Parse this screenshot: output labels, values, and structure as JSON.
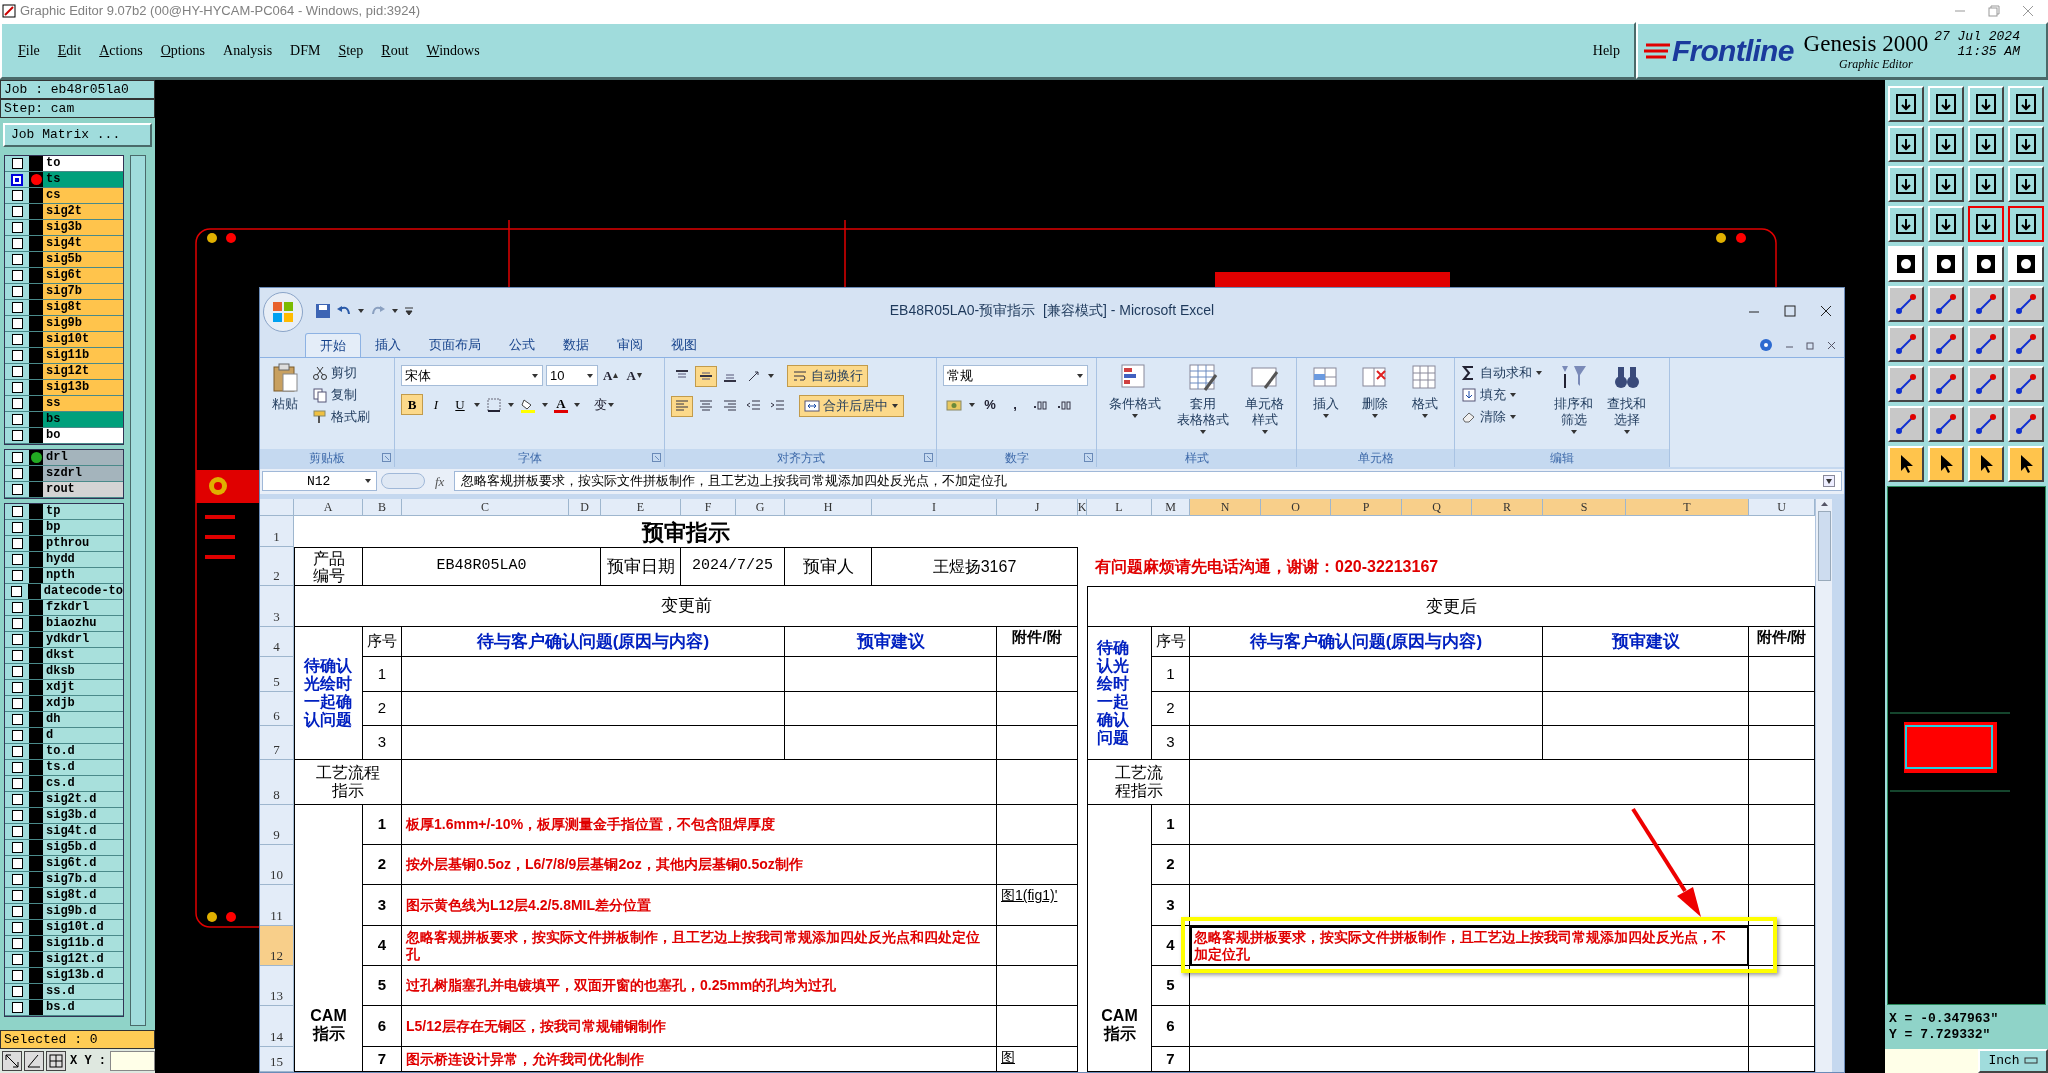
{
  "title_bar": {
    "title": "Graphic Editor 9.07b2 (00@HY-HYCAM-PC064 - Windows, pid:3924)"
  },
  "menu": {
    "items": [
      {
        "label": "File",
        "mnemonic": true
      },
      {
        "label": "Edit",
        "mnemonic": true
      },
      {
        "label": "Actions",
        "mnemonic": true
      },
      {
        "label": "Options",
        "mnemonic": true
      },
      {
        "label": "Analysis",
        "mnemonic": false
      },
      {
        "label": "DFM",
        "mnemonic": false
      },
      {
        "label": "Step",
        "mnemonic": true
      },
      {
        "label": "Rout",
        "mnemonic": true
      },
      {
        "label": "Windows",
        "mnemonic": true
      }
    ],
    "help": "Help"
  },
  "brand": {
    "logo": "Frontline",
    "product": "Genesis 2000",
    "subtitle": "Graphic Editor",
    "date": "27 Jul 2024",
    "time": "11:35 AM"
  },
  "job_panel": {
    "job": "Job : eb48r05la0",
    "step": "Step: cam",
    "matrix_button": "Job Matrix ...",
    "layer_groups": [
      {
        "layers": [
          {
            "name": "to",
            "color": "#ffffff",
            "selected": false
          },
          {
            "name": "ts",
            "color": "#00a07c",
            "selected": true,
            "dot": {
              "color": "#ff0000"
            }
          },
          {
            "name": "cs",
            "color": "#ffc44c",
            "selected": false
          },
          {
            "name": "sig2t",
            "color": "#ffc44c",
            "selected": false
          },
          {
            "name": "sig3b",
            "color": "#ffc44c",
            "selected": false
          },
          {
            "name": "sig4t",
            "color": "#ffc44c",
            "selected": false
          },
          {
            "name": "sig5b",
            "color": "#ffc44c",
            "selected": false
          },
          {
            "name": "sig6t",
            "color": "#ffc44c",
            "selected": false
          },
          {
            "name": "sig7b",
            "color": "#ffc44c",
            "selected": false
          },
          {
            "name": "sig8t",
            "color": "#ffc44c",
            "selected": false
          },
          {
            "name": "sig9b",
            "color": "#ffc44c",
            "selected": false
          },
          {
            "name": "sig10t",
            "color": "#ffc44c",
            "selected": false
          },
          {
            "name": "sig11b",
            "color": "#ffc44c",
            "selected": false
          },
          {
            "name": "sig12t",
            "color": "#ffc44c",
            "selected": false
          },
          {
            "name": "sig13b",
            "color": "#ffc44c",
            "selected": false
          },
          {
            "name": "ss",
            "color": "#ffc44c",
            "selected": false
          },
          {
            "name": "bs",
            "color": "#00a07c",
            "selected": false
          },
          {
            "name": "bo",
            "color": "#ffffff",
            "selected": false
          }
        ]
      },
      {
        "layers": [
          {
            "name": "drl",
            "color": "#a4b4bc",
            "selected": false,
            "dot": {
              "color": "#22aa22"
            }
          },
          {
            "name": "szdrl",
            "color": "#a4b4bc",
            "selected": false
          },
          {
            "name": "rout",
            "color": "#d4d4d4",
            "selected": false
          }
        ]
      },
      {
        "layers": [
          {
            "name": "tp",
            "color": "#a8e0dc",
            "selected": false
          },
          {
            "name": "bp",
            "color": "#a8e0dc",
            "selected": false
          },
          {
            "name": "pthrou",
            "color": "#a8e0dc",
            "selected": false
          },
          {
            "name": "hydd",
            "color": "#a8e0dc",
            "selected": false
          },
          {
            "name": "npth",
            "color": "#a8e0dc",
            "selected": false
          },
          {
            "name": "datecode-to",
            "color": "#a8e0dc",
            "selected": false
          },
          {
            "name": "fzkdrl",
            "color": "#a8e0dc",
            "selected": false
          },
          {
            "name": "biaozhu",
            "color": "#a8e0dc",
            "selected": false
          },
          {
            "name": "ydkdrl",
            "color": "#a8e0dc",
            "selected": false
          },
          {
            "name": "dkst",
            "color": "#a8e0dc",
            "selected": false
          },
          {
            "name": "dksb",
            "color": "#a8e0dc",
            "selected": false
          },
          {
            "name": "xdjt",
            "color": "#a8e0dc",
            "selected": false
          },
          {
            "name": "xdjb",
            "color": "#a8e0dc",
            "selected": false
          },
          {
            "name": "dh",
            "color": "#a8e0dc",
            "selected": false
          },
          {
            "name": "d",
            "color": "#a8e0dc",
            "selected": false
          },
          {
            "name": "to.d",
            "color": "#a8e0dc",
            "selected": false
          },
          {
            "name": "ts.d",
            "color": "#a8e0dc",
            "selected": false
          },
          {
            "name": "cs.d",
            "color": "#a8e0dc",
            "selected": false
          },
          {
            "name": "sig2t.d",
            "color": "#a8e0dc",
            "selected": false
          },
          {
            "name": "sig3b.d",
            "color": "#a8e0dc",
            "selected": false
          },
          {
            "name": "sig4t.d",
            "color": "#a8e0dc",
            "selected": false
          },
          {
            "name": "sig5b.d",
            "color": "#a8e0dc",
            "selected": false
          },
          {
            "name": "sig6t.d",
            "color": "#a8e0dc",
            "selected": false
          },
          {
            "name": "sig7b.d",
            "color": "#a8e0dc",
            "selected": false
          },
          {
            "name": "sig8t.d",
            "color": "#a8e0dc",
            "selected": false
          },
          {
            "name": "sig9b.d",
            "color": "#a8e0dc",
            "selected": false
          },
          {
            "name": "sig10t.d",
            "color": "#a8e0dc",
            "selected": false
          },
          {
            "name": "sig11b.d",
            "color": "#a8e0dc",
            "selected": false
          },
          {
            "name": "sig12t.d",
            "color": "#a8e0dc",
            "selected": false
          },
          {
            "name": "sig13b.d",
            "color": "#a8e0dc",
            "selected": false
          },
          {
            "name": "ss.d",
            "color": "#a8e0dc",
            "selected": false
          },
          {
            "name": "bs.d",
            "color": "#a8e0dc",
            "selected": false
          }
        ]
      }
    ],
    "selected": "Selected : 0",
    "xy_label": "X Y :"
  },
  "excel": {
    "title": "EB48R05LA0-预审指示  [兼容模式] - Microsoft Excel",
    "tabs": [
      {
        "label": "开始",
        "selected": true
      },
      {
        "label": "插入",
        "selected": false
      },
      {
        "label": "页面布局",
        "selected": false
      },
      {
        "label": "公式",
        "selected": false
      },
      {
        "label": "数据",
        "selected": false
      },
      {
        "label": "审阅",
        "selected": false
      },
      {
        "label": "视图",
        "selected": false
      }
    ],
    "groups": [
      {
        "kind": "clipboard",
        "label": "剪贴板",
        "buttons": [
          "粘贴",
          "剪切",
          "复制",
          "格式刷"
        ]
      },
      {
        "kind": "font",
        "label": "字体",
        "font_name": "宋体",
        "font_size": "10",
        "size_buttons": [
          "A",
          "A"
        ],
        "style_buttons": [
          {
            "label": "B",
            "on": true
          },
          {
            "label": "I",
            "on": false
          },
          {
            "label": "U",
            "on": false
          }
        ],
        "color_button": "A",
        "phonetic_button": "变"
      },
      {
        "kind": "alignment",
        "label": "对齐方式",
        "vertical": [
          {
            "on": false
          },
          {
            "on": true
          },
          {
            "on": false
          }
        ],
        "horizontal": [
          {
            "on": true
          },
          {
            "on": false
          },
          {
            "on": false
          }
        ],
        "wrap": {
          "label": "自动换行",
          "on": true
        },
        "merge": {
          "label": "合并后居中",
          "on": true
        }
      },
      {
        "kind": "number",
        "label": "数字",
        "format": "常规",
        "buttons": [
          "%",
          ","
        ]
      },
      {
        "kind": "styles",
        "label": "样式",
        "buttons": [
          [
            "条件格式"
          ],
          [
            "套用",
            "表格格式"
          ],
          [
            "单元格",
            "样式"
          ]
        ]
      },
      {
        "kind": "cells",
        "label": "单元格",
        "buttons": [
          "插入",
          "删除",
          "格式"
        ]
      },
      {
        "kind": "editing",
        "label": "编辑",
        "small": [
          "自动求和",
          "填充",
          "清除"
        ],
        "large": [
          [
            "排序和",
            "筛选"
          ],
          [
            "查找和",
            "选择"
          ]
        ]
      }
    ],
    "name_box": "N12",
    "fx": "fx",
    "formula": "忽略客规拼板要求，按实际文件拼板制作，且工艺边上按我司常规添加四处反光点，不加定位孔",
    "columns": [
      {
        "label": "A",
        "selected": false
      },
      {
        "label": "B",
        "selected": false
      },
      {
        "label": "C",
        "selected": false
      },
      {
        "label": "D",
        "selected": false
      },
      {
        "label": "E",
        "selected": false
      },
      {
        "label": "F",
        "selected": false
      },
      {
        "label": "G",
        "selected": false
      },
      {
        "label": "H",
        "selected": false
      },
      {
        "label": "I",
        "selected": false
      },
      {
        "label": "J",
        "selected": false
      },
      {
        "label": "K",
        "selected": false
      },
      {
        "label": "L",
        "selected": false
      },
      {
        "label": "M",
        "selected": false
      },
      {
        "label": "N",
        "selected": true
      },
      {
        "label": "O",
        "selected": true
      },
      {
        "label": "P",
        "selected": true
      },
      {
        "label": "Q",
        "selected": true
      },
      {
        "label": "R",
        "selected": true
      },
      {
        "label": "S",
        "selected": true
      },
      {
        "label": "T",
        "selected": true
      },
      {
        "label": "U",
        "selected": false
      }
    ],
    "rows": [
      {
        "label": "1",
        "selected": false
      },
      {
        "label": "2",
        "selected": false
      },
      {
        "label": "3",
        "selected": false
      },
      {
        "label": "4",
        "selected": false
      },
      {
        "label": "5",
        "selected": false
      },
      {
        "label": "6",
        "selected": false
      },
      {
        "label": "7",
        "selected": false
      },
      {
        "label": "8",
        "selected": false
      },
      {
        "label": "9",
        "selected": false
      },
      {
        "label": "10",
        "selected": false
      },
      {
        "label": "11",
        "selected": false
      },
      {
        "label": "12",
        "selected": true
      },
      {
        "label": "13",
        "selected": false
      },
      {
        "label": "14",
        "selected": false
      },
      {
        "label": "15",
        "selected": false
      }
    ],
    "sheet_title": "预审指示",
    "info": {
      "product_label": "产品编号",
      "product_no": "EB48R05LA0",
      "date_label": "预审日期",
      "date": "2024/7/25",
      "reviewer_label": "预审人",
      "reviewer": "王煜扬3167"
    },
    "notice": "有问题麻烦请先电话沟通，谢谢：020-32213167",
    "sections": [
      {
        "heading": "变更前",
        "confirm_label": "待确认光绘时一起确认问题",
        "seq_header": "序号",
        "question_header": "待与客户确认问题(原因与内容)",
        "suggestion_header": "预审建议",
        "attachment_header": "附件/附",
        "confirm_rows": [
          {
            "no": "1"
          },
          {
            "no": "2"
          },
          {
            "no": "3"
          }
        ],
        "process_label": "工艺流程指示",
        "cam_label": "CAM指示",
        "cam_rows": [
          {
            "no": "1",
            "text": "板厚1.6mm+/-10%，板厚测量金手指位置，不包含阻焊厚度",
            "selected": false
          },
          {
            "no": "2",
            "text": "按外层基铜0.5oz，L6/7/8/9层基铜2oz，其他内层基铜0.5oz制作",
            "selected": false
          },
          {
            "no": "3",
            "text": "图示黄色线为L12层4.2/5.8MIL差分位置",
            "attachment": "图1(fig1)'",
            "selected": false
          },
          {
            "no": "4",
            "text": "忽略客规拼板要求，按实际文件拼板制作，且工艺边上按我司常规添加四处反光点和四处定位孔",
            "selected": false
          },
          {
            "no": "5",
            "text": "过孔树脂塞孔并电镀填平，双面开窗的也塞孔，0.25mm的孔均为过孔",
            "selected": false
          },
          {
            "no": "6",
            "text": "L5/12层存在无铜区，按我司常规铺铜制作",
            "selected": false
          },
          {
            "no": "7",
            "text": "图示桥连设计异常，允许我司优化制作",
            "attachment": "图",
            "selected": false
          }
        ]
      },
      {
        "heading": "变更后",
        "confirm_label": "待确认光绘时一起确认问题",
        "seq_header": "序号",
        "question_header": "待与客户确认问题(原因与内容)",
        "suggestion_header": "预审建议",
        "attachment_header": "附件/附",
        "confirm_rows": [
          {
            "no": "1"
          },
          {
            "no": "2"
          },
          {
            "no": "3"
          }
        ],
        "process_label": "工艺流程指示",
        "cam_label": "CAM指示",
        "cam_rows": [
          {
            "no": "1",
            "selected": false
          },
          {
            "no": "2",
            "selected": false
          },
          {
            "no": "3",
            "selected": false
          },
          {
            "no": "4",
            "text": "忽略客规拼板要求，按实际文件拼板制作，且工艺边上按我司常规添加四处反光点，不加定位孔",
            "selected": true
          },
          {
            "no": "5",
            "selected": false
          },
          {
            "no": "6",
            "selected": false
          },
          {
            "no": "7",
            "selected": false
          }
        ]
      }
    ]
  },
  "view_panel": {
    "tools": [
      {
        "kind": "view",
        "on": false
      },
      {
        "kind": "view",
        "on": false
      },
      {
        "kind": "view",
        "on": false
      },
      {
        "kind": "view",
        "on": false
      },
      {
        "kind": "view",
        "on": false
      },
      {
        "kind": "view",
        "on": false
      },
      {
        "kind": "view",
        "on": false
      },
      {
        "kind": "view",
        "on": false
      },
      {
        "kind": "view",
        "on": false
      },
      {
        "kind": "view",
        "on": false
      },
      {
        "kind": "view",
        "on": false
      },
      {
        "kind": "view",
        "on": false
      },
      {
        "kind": "view",
        "on": false
      },
      {
        "kind": "view",
        "on": false
      },
      {
        "kind": "view",
        "on": true
      },
      {
        "kind": "view",
        "on": true
      },
      {
        "kind": "display",
        "on": false
      },
      {
        "kind": "display",
        "on": false
      },
      {
        "kind": "display",
        "on": false
      },
      {
        "kind": "display",
        "on": false
      },
      {
        "kind": "edit",
        "on": false
      },
      {
        "kind": "edit",
        "on": false
      },
      {
        "kind": "edit",
        "on": false
      },
      {
        "kind": "edit",
        "on": false
      },
      {
        "kind": "edit",
        "on": false
      },
      {
        "kind": "edit",
        "on": false
      },
      {
        "kind": "edit",
        "on": false
      },
      {
        "kind": "edit",
        "on": false
      },
      {
        "kind": "edit",
        "on": false
      },
      {
        "kind": "edit",
        "on": false
      },
      {
        "kind": "edit",
        "on": false
      },
      {
        "kind": "edit",
        "on": false
      },
      {
        "kind": "edit",
        "on": false
      },
      {
        "kind": "edit",
        "on": false
      },
      {
        "kind": "edit",
        "on": false
      },
      {
        "kind": "edit",
        "on": false
      },
      {
        "kind": "select",
        "on": false
      },
      {
        "kind": "select",
        "on": false
      },
      {
        "kind": "select",
        "on": false
      },
      {
        "kind": "select",
        "on": false
      }
    ],
    "x": "X = -0.347963\"",
    "y": "Y = 7.729332\"",
    "units": "Inch"
  }
}
